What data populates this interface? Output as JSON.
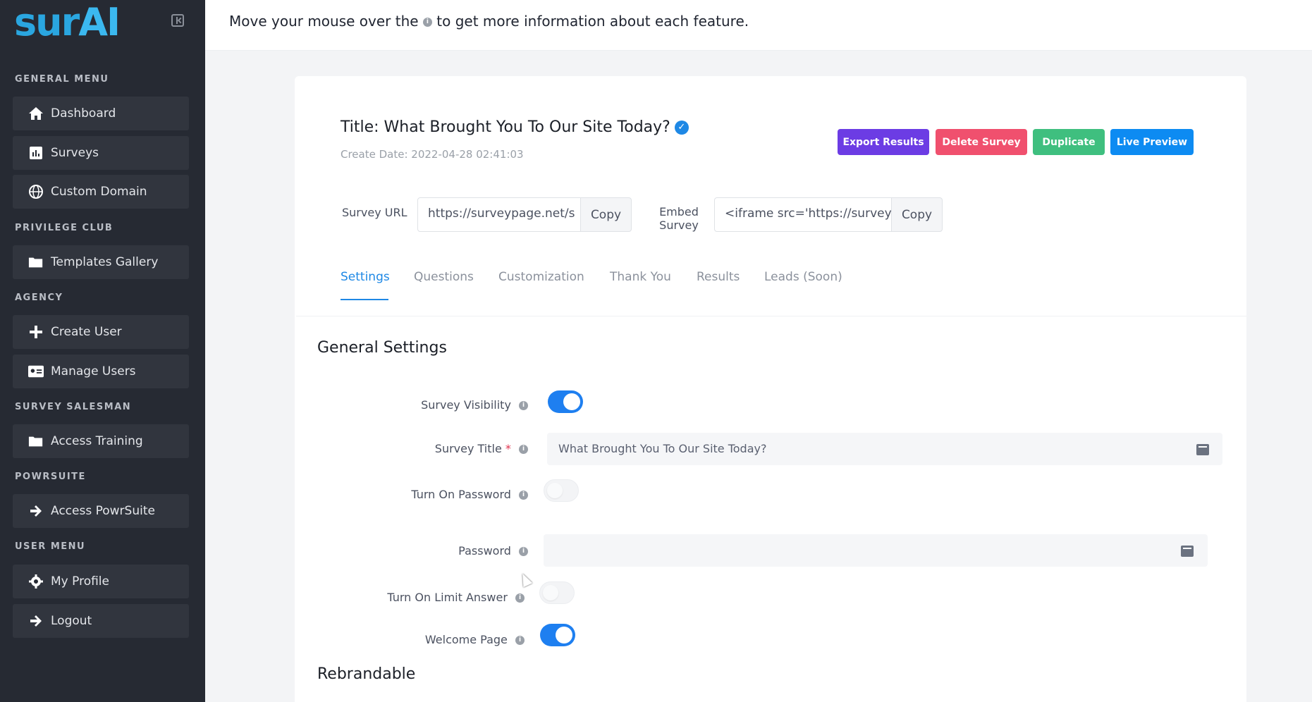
{
  "app": {
    "logo_main": "sur",
    "logo_ai": "AI"
  },
  "topbar": {
    "message_before": "Move your mouse over the",
    "message_after": "to get more information about each feature.",
    "info_glyph": "i"
  },
  "sidebar": {
    "sections": [
      {
        "label": "GENERAL MENU",
        "items": [
          {
            "label": "Dashboard",
            "icon": "home-icon"
          },
          {
            "label": "Surveys",
            "icon": "chart-icon"
          },
          {
            "label": "Custom Domain",
            "icon": "globe-icon"
          }
        ]
      },
      {
        "label": "PRIVILEGE CLUB",
        "items": [
          {
            "label": "Templates Gallery",
            "icon": "folder-icon"
          }
        ]
      },
      {
        "label": "AGENCY",
        "items": [
          {
            "label": "Create User",
            "icon": "plus-icon"
          },
          {
            "label": "Manage Users",
            "icon": "id-card-icon"
          }
        ]
      },
      {
        "label": "SURVEY SALESMAN",
        "items": [
          {
            "label": "Access Training",
            "icon": "folder-icon"
          }
        ]
      },
      {
        "label": "POWRSUITE",
        "items": [
          {
            "label": "Access PowrSuite",
            "icon": "arrow-right-icon"
          }
        ]
      },
      {
        "label": "USER MENU",
        "items": [
          {
            "label": "My Profile",
            "icon": "gear-icon"
          },
          {
            "label": "Logout",
            "icon": "logout-icon"
          }
        ]
      }
    ]
  },
  "survey": {
    "title": "Title: What Brought You To Our Site Today?",
    "create_date": "Create Date: 2022-04-28 02:41:03"
  },
  "actions": {
    "export": "Export Results",
    "delete": "Delete Survey",
    "duplicate": "Duplicate",
    "preview": "Live Preview"
  },
  "links": {
    "url_label": "Survey URL",
    "url_value": "https://surveypage.net/s",
    "embed_label_1": "Embed",
    "embed_label_2": "Survey",
    "embed_value": "<iframe src='https://surveyp",
    "copy": "Copy"
  },
  "tabs": [
    "Settings",
    "Questions",
    "Customization",
    "Thank You",
    "Results",
    "Leads (Soon)"
  ],
  "general_settings": {
    "heading": "General Settings",
    "survey_visibility": {
      "label": "Survey Visibility",
      "on": true
    },
    "survey_title": {
      "label": "Survey Title",
      "required_mark": "*",
      "value": "What Brought You To Our Site Today?"
    },
    "turn_on_password": {
      "label": "Turn On Password",
      "on": false
    },
    "password": {
      "label": "Password",
      "value": ""
    },
    "limit_answer": {
      "label": "Turn On Limit Answer",
      "on": false
    },
    "welcome_page": {
      "label": "Welcome Page",
      "on": true
    }
  },
  "rebrandable": {
    "heading": "Rebrandable"
  },
  "colors": {
    "sidebar": "#262a33",
    "accent": "#1e88e5",
    "export": "#6c3ce4",
    "delete": "#f0506e",
    "duplicate": "#3fbf7f",
    "preview": "#0d8bf2"
  }
}
